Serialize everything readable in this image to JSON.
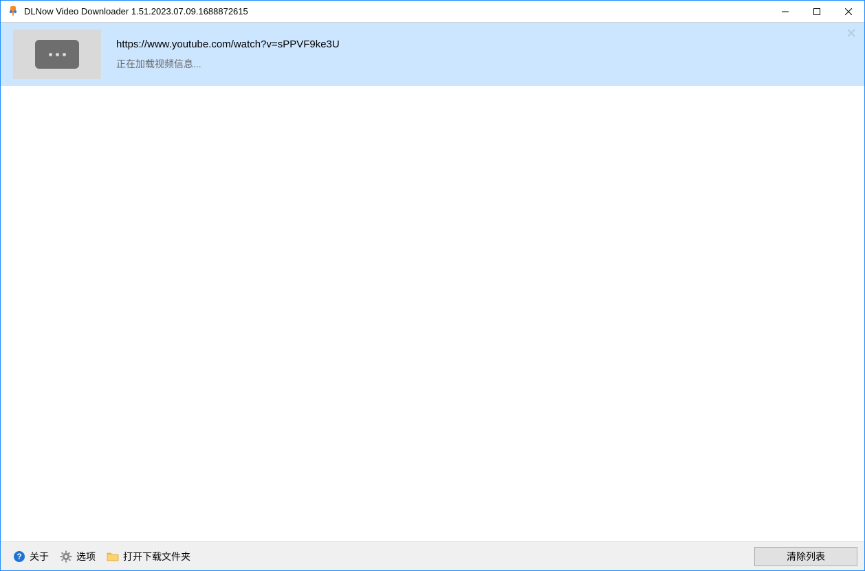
{
  "window": {
    "title": "DLNow Video Downloader 1.51.2023.07.09.1688872615"
  },
  "list": {
    "items": [
      {
        "url": "https://www.youtube.com/watch?v=sPPVF9ke3U",
        "status": "正在加载视频信息..."
      }
    ]
  },
  "toolbar": {
    "about_label": "关于",
    "options_label": "选项",
    "open_folder_label": "打开下载文件夹",
    "clear_list_label": "清除列表"
  }
}
